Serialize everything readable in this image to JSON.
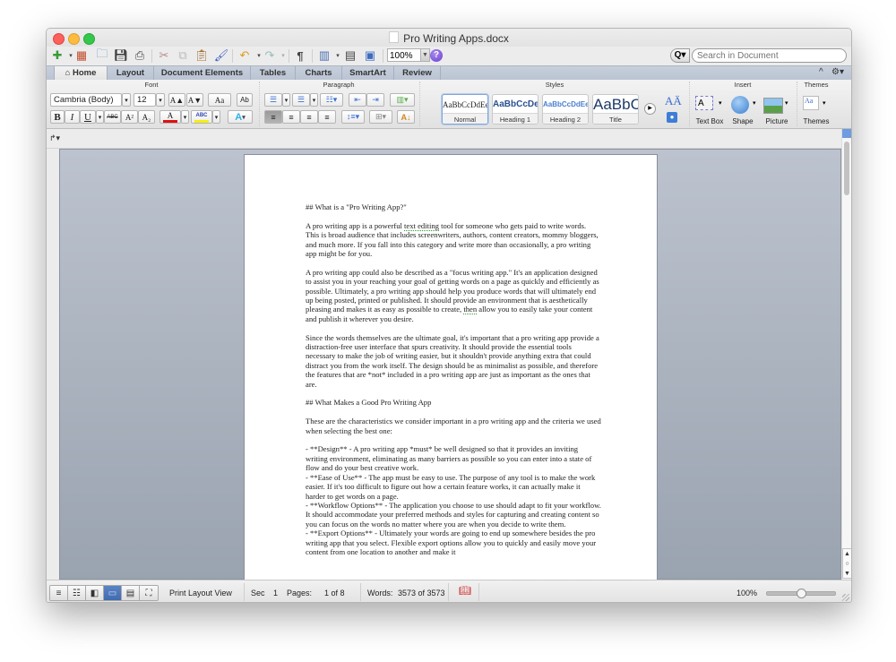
{
  "window": {
    "title": "Pro Writing Apps.docx"
  },
  "toolbar": {
    "buttons": [
      "new-document",
      "gallery",
      "open",
      "save",
      "print",
      "cut",
      "copy",
      "paste",
      "format-painter",
      "undo",
      "redo",
      "show-formatting",
      "sidebar",
      "media-browser",
      "toolbox"
    ],
    "zoom": "100%",
    "help_label": "?",
    "search_placeholder": "Search in Document",
    "search_icon_label": "Q▾"
  },
  "tabs": [
    {
      "label": "Home",
      "active": true
    },
    {
      "label": "Layout"
    },
    {
      "label": "Document Elements"
    },
    {
      "label": "Tables"
    },
    {
      "label": "Charts"
    },
    {
      "label": "SmartArt"
    },
    {
      "label": "Review"
    }
  ],
  "ribbon": {
    "font": {
      "group_label": "Font",
      "font_name": "Cambria (Body)",
      "font_size": "12",
      "grow_label": "A▲",
      "shrink_label": "A▼",
      "change_case_label": "Aa",
      "clear_label": "Ab",
      "bold": "B",
      "italic": "I",
      "underline": "U",
      "strikethrough": "ABC",
      "superscript": "A²",
      "subscript": "A₂",
      "font_color_label": "A",
      "font_color": "#e01010",
      "highlight_label": "ABC",
      "highlight_color": "#f5ee10",
      "text_effects_label": "A"
    },
    "paragraph": {
      "group_label": "Paragraph"
    },
    "styles": {
      "group_label": "Styles",
      "items": [
        {
          "sample": "AaBbCcDdEe",
          "name": "Normal",
          "selected": true
        },
        {
          "sample": "AaBbCcDe",
          "name": "Heading 1"
        },
        {
          "sample": "AaBbCcDdEe",
          "name": "Heading 2"
        },
        {
          "sample": "AaBbC",
          "name": "Title"
        }
      ]
    },
    "insert": {
      "group_label": "Insert",
      "items": [
        {
          "label": "Text Box"
        },
        {
          "label": "Shape"
        },
        {
          "label": "Picture"
        }
      ]
    },
    "themes": {
      "group_label": "Themes",
      "label": "Themes"
    }
  },
  "document": {
    "paragraphs": [
      "## What is a \"Pro Writing App?\"",
      "A pro writing app is a powerful text editing tool for someone who gets paid to write words. This is broad audience that includes screenwriters, authors, content creators, mommy bloggers, and much more. If you fall into this category and write more than occasionally, a pro writing app might be for you.",
      "A pro writing app could also be described as a \"focus writing app.\" It's an application designed to assist you in your reaching your goal of getting words on a page as quickly and efficiently as possible. Ultimately, a pro writing app should help you produce words that will ultimately end up being posted, printed or published. It should provide an environment that is aesthetically pleasing and makes it as easy as possible to create, then allow you to easily take your content and publish it wherever you desire.",
      "Since the words themselves are the ultimate goal, it's important that a pro writing app provide a distraction-free user interface that spurs creativity. It should provide the essential tools necessary to make the job of writing easier, but it shouldn't provide anything extra that could distract you from the work itself. The design should be as minimalist as possible, and therefore the features that are *not* included in a pro writing app are just as important as the ones that are.",
      "## What Makes a Good Pro Writing App",
      "These are the characteristics we consider important in a pro writing app and the criteria we used when selecting the best one:"
    ],
    "list_items": [
      "- **Design** - A pro writing app *must* be well designed so that it provides an inviting writing environment, eliminating as many barriers as possible so you can enter into a state of flow and do your best creative work.",
      "- **Ease of Use** - The app must be easy to use. The purpose of any tool is to make the work easier. If it's too difficult to figure out how a certain feature works, it can actually make it harder to get words on a page.",
      "- **Workflow Options** - The application you choose to use should adapt to fit your workflow. It should accommodate your preferred methods and styles for capturing and creating content so you can focus on the words no matter where you are when you decide to write them.",
      "- **Export Options** - Ultimately your words are going to end up somewhere besides the pro writing app that you select. Flexible export options allow you to quickly and easily move your content from one location to another and make it"
    ]
  },
  "statusbar": {
    "view_mode": "Print Layout View",
    "section_label": "Sec",
    "section_value": "1",
    "pages_label": "Pages:",
    "pages_value": "1 of 8",
    "words_label": "Words:",
    "words_value": "3573 of 3573",
    "zoom": "100%",
    "zoom_slider_fraction": 0.5
  }
}
